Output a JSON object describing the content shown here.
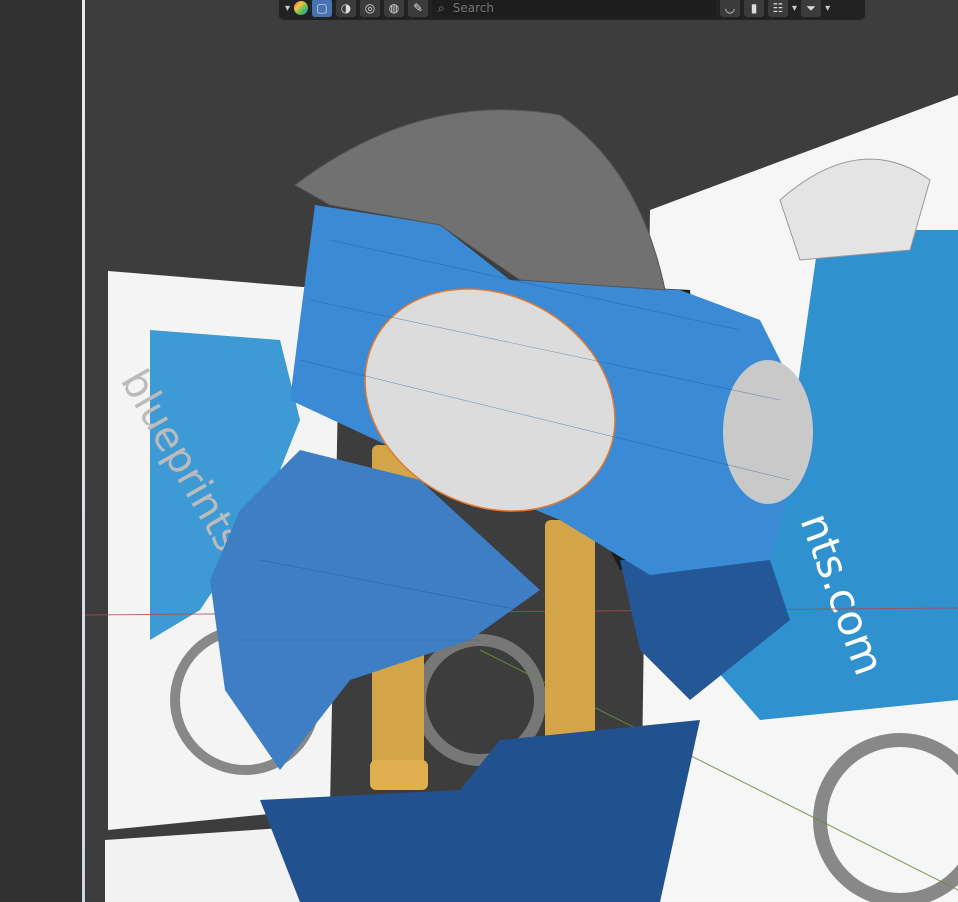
{
  "header": {
    "search_placeholder": "Search",
    "icons": [
      "dropdown-chevron",
      "render-engine-icon",
      "solid-shading-icon",
      "material-shading-icon",
      "rendered-shading-icon",
      "viewport-shading-icon",
      "brush-icon",
      "search-icon",
      "overlay-icon",
      "bookmark-icon",
      "hierarchy-icon",
      "filter-icon"
    ]
  },
  "scene": {
    "reference_watermark_vertical": "blueprints.com",
    "reference_watermark_right": "nts.com",
    "accent_blue": "#3d8fd6",
    "fork_gold": "#d9a84a"
  }
}
